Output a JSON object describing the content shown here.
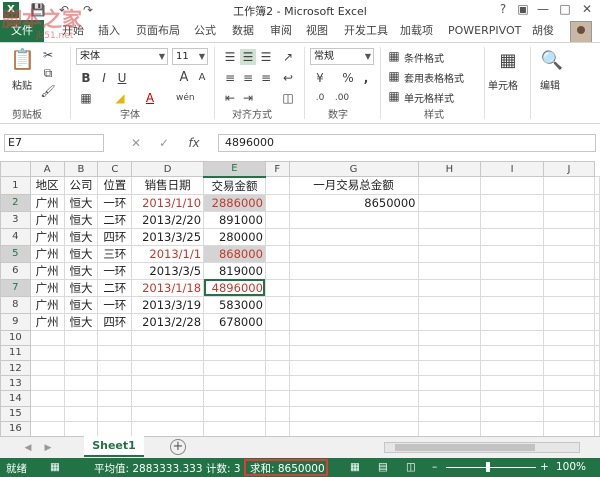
{
  "titlebar": {
    "title": "工作簿2 - Microsoft Excel",
    "logo": "X",
    "icons": [
      "save-icon",
      "undo-icon",
      "redo-icon",
      "help-icon",
      "ribbon-display-icon",
      "minimize-icon",
      "restore-icon",
      "close-icon"
    ]
  },
  "tabs": {
    "file": "文件",
    "items": [
      "开始",
      "插入",
      "页面布局",
      "公式",
      "数据",
      "审阅",
      "视图",
      "开发工具",
      "加载项",
      "POWERPIVOT"
    ],
    "user": "胡俊"
  },
  "ribbon": {
    "clipboard": {
      "paste": "粘贴",
      "label": "剪贴板"
    },
    "font": {
      "name": "宋体",
      "size": "11",
      "label": "字体",
      "bold": "B",
      "italic": "I",
      "underline": "U",
      "grow": "A",
      "shrink": "A",
      "font_color": "A",
      "wen": "wén"
    },
    "align": {
      "label": "对齐方式"
    },
    "number": {
      "format": "常规",
      "percent": "%",
      "comma": ",",
      "label": "数字"
    },
    "styles": {
      "cond": "条件格式",
      "table": "套用表格格式",
      "cell": "单元格样式",
      "label": "样式"
    },
    "cells": {
      "label": "单元格"
    },
    "edit": {
      "label": "编辑"
    }
  },
  "formula_bar": {
    "name_box": "E7",
    "value": "4896000",
    "fx": "fx",
    "cancel": "✕",
    "enter": "✓"
  },
  "sheet": {
    "columns": [
      "A",
      "B",
      "C",
      "D",
      "E",
      "F",
      "G",
      "H",
      "I",
      "J"
    ],
    "rows": [
      [
        "地区",
        "公司",
        "位置",
        "销售日期",
        "交易金额",
        "",
        "一月交易总金额",
        "",
        "",
        ""
      ],
      [
        "广州",
        "恒大",
        "一环",
        "2013/1/10",
        "2886000",
        "",
        "8650000",
        "",
        "",
        ""
      ],
      [
        "广州",
        "恒大",
        "二环",
        "2013/2/20",
        "891000",
        "",
        "",
        "",
        "",
        ""
      ],
      [
        "广州",
        "恒大",
        "四环",
        "2013/3/25",
        "280000",
        "",
        "",
        "",
        "",
        ""
      ],
      [
        "广州",
        "恒大",
        "三环",
        "2013/1/1",
        "868000",
        "",
        "",
        "",
        "",
        ""
      ],
      [
        "广州",
        "恒大",
        "一环",
        "2013/3/5",
        "819000",
        "",
        "",
        "",
        "",
        ""
      ],
      [
        "广州",
        "恒大",
        "二环",
        "2013/1/18",
        "4896000",
        "",
        "",
        "",
        "",
        ""
      ],
      [
        "广州",
        "恒大",
        "一环",
        "2013/3/19",
        "583000",
        "",
        "",
        "",
        "",
        ""
      ],
      [
        "广州",
        "恒大",
        "四环",
        "2013/2/28",
        "678000",
        "",
        "",
        "",
        "",
        ""
      ],
      [
        "",
        "",
        "",
        "",
        "",
        "",
        "",
        "",
        "",
        ""
      ],
      [
        "",
        "",
        "",
        "",
        "",
        "",
        "",
        "",
        "",
        ""
      ],
      [
        "",
        "",
        "",
        "",
        "",
        "",
        "",
        "",
        "",
        ""
      ],
      [
        "",
        "",
        "",
        "",
        "",
        "",
        "",
        "",
        "",
        ""
      ],
      [
        "",
        "",
        "",
        "",
        "",
        "",
        "",
        "",
        "",
        ""
      ],
      [
        "",
        "",
        "",
        "",
        "",
        "",
        "",
        "",
        "",
        ""
      ],
      [
        "",
        "",
        "",
        "",
        "",
        "",
        "",
        "",
        "",
        ""
      ],
      [
        "",
        "",
        "",
        "",
        "",
        "",
        "",
        "",
        "",
        ""
      ]
    ],
    "red_rows": [
      1,
      4,
      6
    ],
    "selected_rows": [
      1,
      4,
      6
    ],
    "active_row": 6,
    "selected_column": "E"
  },
  "sheet_tabs": {
    "sheet1": "Sheet1",
    "add": "+"
  },
  "status": {
    "ready": "就绪",
    "average": "平均值: 2883333.333",
    "count": "计数: 3",
    "sum": "求和: 8650000",
    "zoom": "100%",
    "accent": "#217346",
    "highlight": "#e53935"
  },
  "watermark": {
    "text": "脚本之家",
    "sub": "jb51.net"
  }
}
